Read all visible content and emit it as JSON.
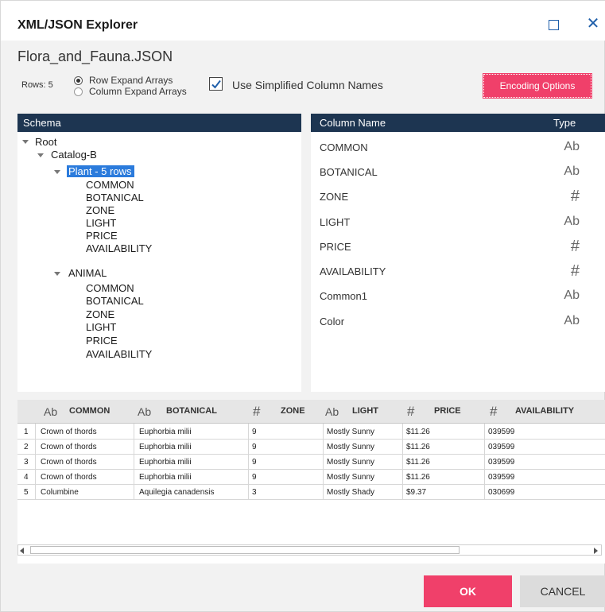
{
  "window": {
    "title": "XML/JSON Explorer"
  },
  "file": {
    "name": "Flora_and_Fauna.JSON"
  },
  "options": {
    "rows_label": "Rows: 5",
    "row_expand": "Row Expand Arrays",
    "column_expand": "Column Expand Arrays",
    "simplified_names": "Use Simplified Column Names",
    "simplified_checked": true,
    "encoding_button": "Encoding Options"
  },
  "schema": {
    "header": "Schema",
    "root": "Root",
    "catalog": "Catalog-B",
    "plant": "Plant - 5 rows",
    "plant_fields": [
      "COMMON",
      "BOTANICAL",
      "ZONE",
      "LIGHT",
      "PRICE",
      "AVAILABILITY"
    ],
    "animal": "ANIMAL",
    "animal_fields": [
      "COMMON",
      "BOTANICAL",
      "ZONE",
      "LIGHT",
      "PRICE",
      "AVAILABILITY"
    ]
  },
  "columns": {
    "header_name": "Column Name",
    "header_type": "Type",
    "items": [
      {
        "name": "COMMON",
        "type": "Ab"
      },
      {
        "name": "BOTANICAL",
        "type": "Ab"
      },
      {
        "name": "ZONE",
        "type": "#"
      },
      {
        "name": "LIGHT",
        "type": "Ab"
      },
      {
        "name": "PRICE",
        "type": "#"
      },
      {
        "name": "AVAILABILITY",
        "type": "#"
      },
      {
        "name": "Common1",
        "type": "Ab"
      },
      {
        "name": "Color",
        "type": "Ab"
      }
    ]
  },
  "grid": {
    "headers": [
      {
        "icon": "Ab",
        "label": "COMMON"
      },
      {
        "icon": "Ab",
        "label": "BOTANICAL"
      },
      {
        "icon": "#",
        "label": "ZONE"
      },
      {
        "icon": "Ab",
        "label": "LIGHT"
      },
      {
        "icon": "#",
        "label": "PRICE"
      },
      {
        "icon": "#",
        "label": "AVAILABILITY"
      }
    ],
    "rows": [
      {
        "n": "1",
        "common": "Crown of thords",
        "botanical": "Euphorbia milii",
        "zone": "9",
        "light": "Mostly Sunny",
        "price": "$11.26",
        "availability": "039599"
      },
      {
        "n": "2",
        "common": "Crown of thords",
        "botanical": "Euphorbia milii",
        "zone": "9",
        "light": "Mostly Sunny",
        "price": "$11.26",
        "availability": "039599"
      },
      {
        "n": "3",
        "common": "Crown of thords",
        "botanical": "Euphorbia milii",
        "zone": "9",
        "light": "Mostly Sunny",
        "price": "$11.26",
        "availability": "039599"
      },
      {
        "n": "4",
        "common": "Crown of thords",
        "botanical": "Euphorbia milii",
        "zone": "9",
        "light": "Mostly Sunny",
        "price": "$11.26",
        "availability": "039599"
      },
      {
        "n": "5",
        "common": "Columbine",
        "botanical": "Aquilegia canadensis",
        "zone": "3",
        "light": "Mostly Shady",
        "price": "$9.37",
        "availability": "030699"
      }
    ]
  },
  "footer": {
    "ok": "OK",
    "cancel": "CANCEL"
  },
  "colors": {
    "accent": "#f0406a",
    "header_bg": "#1d3551",
    "selection": "#2b7bdc"
  }
}
